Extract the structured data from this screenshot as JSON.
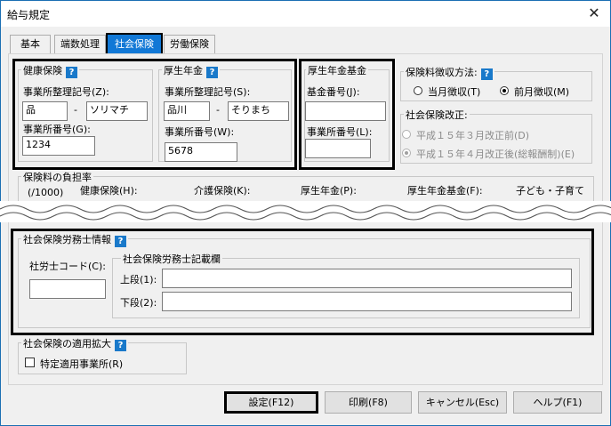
{
  "window": {
    "title": "給与規定",
    "close_glyph": "✕"
  },
  "tabs": [
    "基本",
    "端数処理",
    "社会保険",
    "労働保険"
  ],
  "kenko": {
    "title": "健康保険",
    "seiri_label": "事業所整理記号(Z):",
    "seiri_1": "品",
    "seiri_2": "ソリマチ",
    "bango_label": "事業所番号(G):",
    "bango": "1234"
  },
  "kosei": {
    "title": "厚生年金",
    "seiri_label": "事業所整理記号(S):",
    "seiri_1": "品川",
    "seiri_2": "そりまち",
    "bango_label": "事業所番号(W):",
    "bango": "5678"
  },
  "kikin": {
    "title": "厚生年金基金",
    "kikin_label": "基金番号(J):",
    "kikin_value": "",
    "bango_label": "事業所番号(L):",
    "bango": ""
  },
  "choshu": {
    "title": "保険料徴収方法:",
    "options": [
      "当月徴収(T)",
      "前月徴収(M)"
    ],
    "selected": "前月徴収(M)"
  },
  "kaisei": {
    "title": "社会保険改正:",
    "options": [
      "平成１５年３月改正前(D)",
      "平成１５年４月改正後(総報酬制)(E)"
    ]
  },
  "futan": {
    "title": "保険料の負担率",
    "unit": "(/1000)",
    "columns": [
      "健康保険(H):",
      "介護保険(K):",
      "厚生年金(P):",
      "厚生年金基金(F):",
      "子ども・子育て"
    ]
  },
  "sharoshi": {
    "title": "社会保険労務士情報",
    "code_label": "社労士コード(C):",
    "code_value": "",
    "kisai_title": "社会保険労務士記載欄",
    "upper_label": "上段(1):",
    "lower_label": "下段(2):"
  },
  "kakudai": {
    "title": "社会保険の適用拡大",
    "checkbox_label": "特定適用事業所(R)"
  },
  "buttons": {
    "save": "設定(F12)",
    "print": "印刷(F8)",
    "cancel": "キャンセル(Esc)",
    "help": "ヘルプ(F1)"
  },
  "colors": {
    "accent": "#1178d6",
    "help_icon": "#1979ca",
    "highlight_border": "#000000"
  }
}
